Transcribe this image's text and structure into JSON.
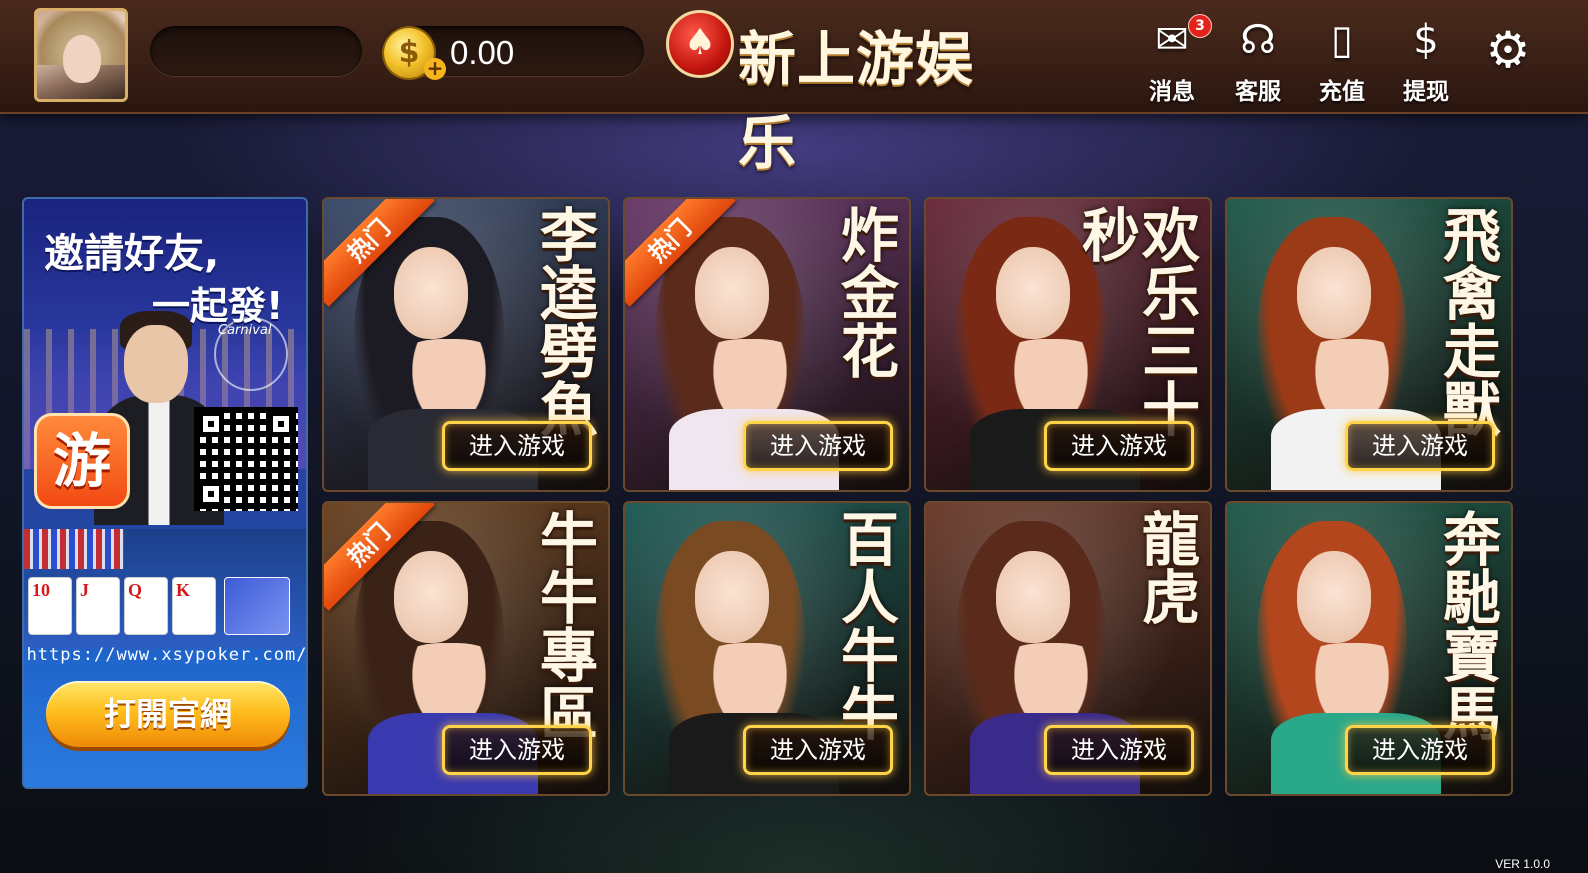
{
  "header": {
    "coin_balance": "0.00",
    "coin_symbol": "$",
    "coin_plus": "+",
    "logo_mark": "♠",
    "logo_text": "新上游娱乐",
    "nav": [
      {
        "label": "消息",
        "icon": "mail-icon",
        "glyph": "✉",
        "badge": "3"
      },
      {
        "label": "客服",
        "icon": "headset-icon",
        "glyph": "☊"
      },
      {
        "label": "充值",
        "icon": "recharge-phone-icon",
        "glyph": "▯"
      },
      {
        "label": "提现",
        "icon": "withdraw-coin-icon",
        "glyph": "$"
      }
    ],
    "settings_glyph": "⚙"
  },
  "promo": {
    "title_line1": "邀請好友,",
    "title_line2": "一起發!",
    "wheel_label": "Carnival",
    "app_icon_text": "游",
    "cards": [
      "10",
      "J",
      "Q",
      "K"
    ],
    "url": "https://www.xsypoker.com/",
    "button": "打開官網"
  },
  "games": [
    {
      "name": "李逵劈魚",
      "hot": true,
      "hot_label": "热门",
      "enter": "进入游戏",
      "theme": "#3a4a6a"
    },
    {
      "name": "炸金花",
      "hot": true,
      "hot_label": "热门",
      "enter": "进入游戏",
      "theme": "#6a3a6a"
    },
    {
      "name": "欢乐三十秒",
      "hot": false,
      "hot_label": "",
      "enter": "进入游戏",
      "theme": "#6a2a3a"
    },
    {
      "name": "飛禽走獸",
      "hot": false,
      "hot_label": "",
      "enter": "进入游戏",
      "theme": "#1f5a4a"
    },
    {
      "name": "牛牛專區",
      "hot": true,
      "hot_label": "热门",
      "enter": "进入游戏",
      "theme": "#6a4222"
    },
    {
      "name": "百人牛牛",
      "hot": false,
      "hot_label": "",
      "enter": "进入游戏",
      "theme": "#1f5a55"
    },
    {
      "name": "龍虎",
      "hot": false,
      "hot_label": "",
      "enter": "进入游戏",
      "theme": "#6a3a2a"
    },
    {
      "name": "奔馳寶馬",
      "hot": false,
      "hot_label": "",
      "enter": "进入游戏",
      "theme": "#1f5a4a"
    }
  ],
  "version": "VER 1.0.0"
}
